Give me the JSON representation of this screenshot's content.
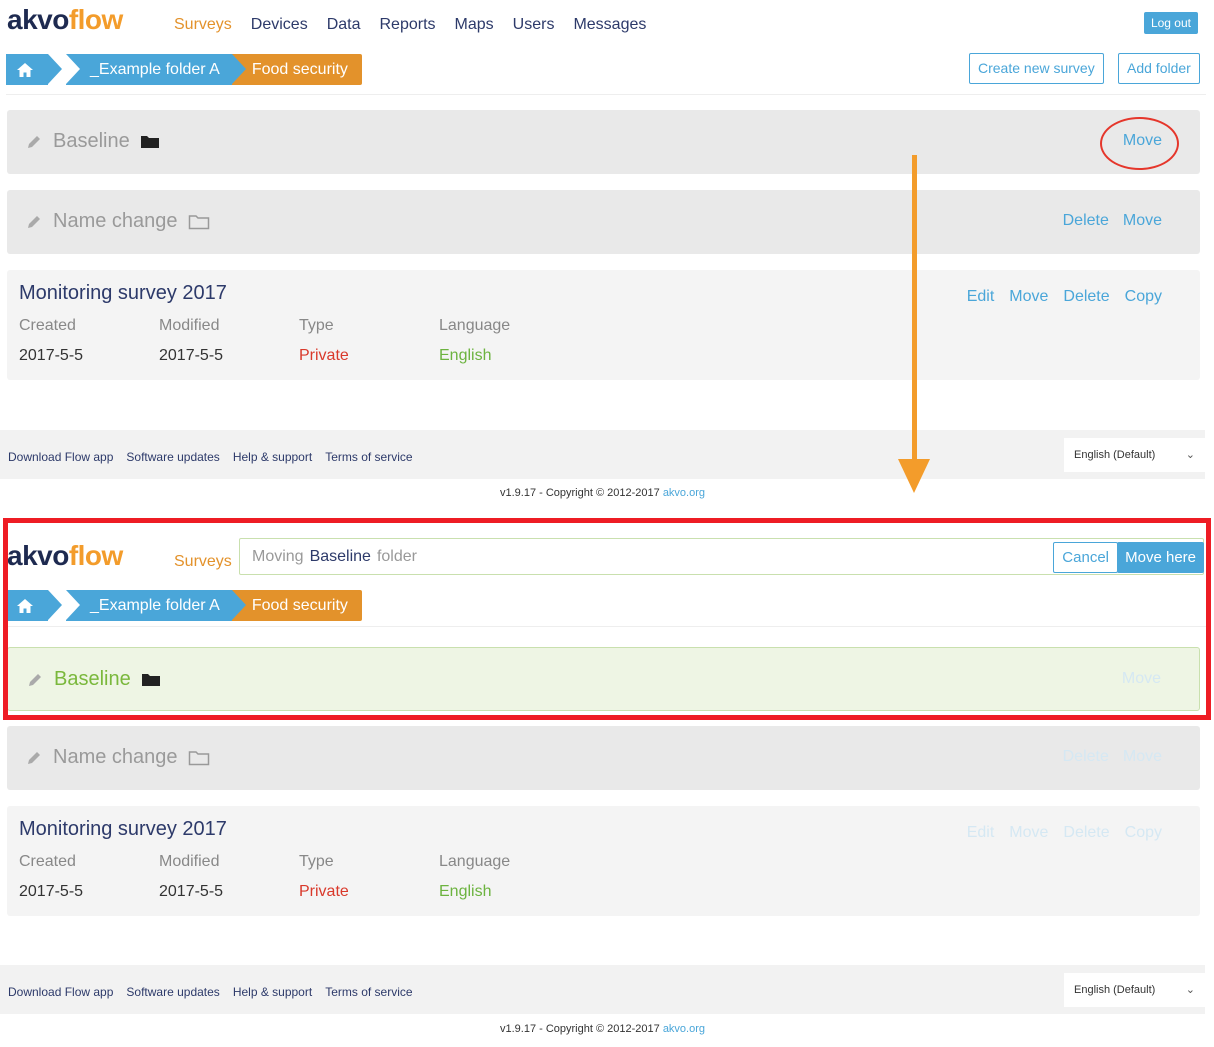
{
  "logo": {
    "part1": "akvo",
    "part2": "flow"
  },
  "nav": [
    "Surveys",
    "Devices",
    "Data",
    "Reports",
    "Maps",
    "Users",
    "Messages"
  ],
  "logout": "Log out",
  "breadcrumb": {
    "folder": "_Example folder A",
    "current": "Food security"
  },
  "toolbar": {
    "create_survey": "Create new survey",
    "add_folder": "Add folder"
  },
  "folders": [
    {
      "name": "Baseline",
      "icon": "folder-filled-icon"
    },
    {
      "name": "Name change",
      "icon": "folder-outline-icon"
    }
  ],
  "actions": {
    "edit": "Edit",
    "move": "Move",
    "delete": "Delete",
    "copy": "Copy"
  },
  "survey": {
    "title": "Monitoring survey 2017",
    "labels": {
      "created": "Created",
      "modified": "Modified",
      "type": "Type",
      "language": "Language"
    },
    "values": {
      "created": "2017-5-5",
      "modified": "2017-5-5",
      "type": "Private",
      "language": "English"
    }
  },
  "footer": {
    "links": [
      "Download Flow app",
      "Software updates",
      "Help & support",
      "Terms of service"
    ],
    "language": "English (Default)",
    "copyright": "v1.9.17 - Copyright © 2012-2017",
    "copyright_link": "akvo.org"
  },
  "moving": {
    "prefix": "Moving",
    "folder": "Baseline",
    "suffix": "folder",
    "cancel": "Cancel",
    "move_here": "Move here"
  },
  "colors": {
    "accent": "#4aa6d9",
    "orange": "#e3922b",
    "annotation_red": "#ee1c24",
    "arrow": "#f39c2b"
  }
}
